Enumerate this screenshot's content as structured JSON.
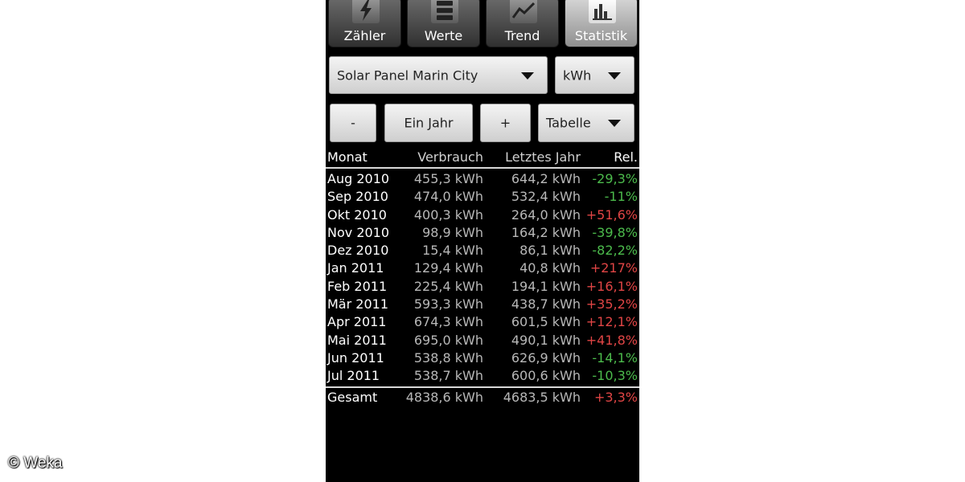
{
  "watermark": "© Weka",
  "tabs": [
    {
      "label": "Zähler",
      "icon": "bolt-icon",
      "active": false
    },
    {
      "label": "Werte",
      "icon": "list-icon",
      "active": false
    },
    {
      "label": "Trend",
      "icon": "trend-icon",
      "active": false
    },
    {
      "label": "Statistik",
      "icon": "bar-chart-icon",
      "active": true
    }
  ],
  "controls": {
    "meter_select": "Solar Panel Marin City",
    "unit_select": "kWh",
    "minus_label": "-",
    "period_label": "Ein Jahr",
    "plus_label": "+",
    "view_select": "Tabelle"
  },
  "table": {
    "headers": {
      "month": "Monat",
      "consumption": "Verbrauch",
      "last_year": "Letztes Jahr",
      "relative": "Rel."
    },
    "rows": [
      {
        "month": "Aug 2010",
        "consumption": "455,3 kWh",
        "last_year": "644,2 kWh",
        "relative": "-29,3%"
      },
      {
        "month": "Sep 2010",
        "consumption": "474,0 kWh",
        "last_year": "532,4 kWh",
        "relative": "-11%"
      },
      {
        "month": "Okt 2010",
        "consumption": "400,3 kWh",
        "last_year": "264,0 kWh",
        "relative": "+51,6%"
      },
      {
        "month": "Nov 2010",
        "consumption": "98,9 kWh",
        "last_year": "164,2 kWh",
        "relative": "-39,8%"
      },
      {
        "month": "Dez 2010",
        "consumption": "15,4 kWh",
        "last_year": "86,1 kWh",
        "relative": "-82,2%"
      },
      {
        "month": "Jan 2011",
        "consumption": "129,4 kWh",
        "last_year": "40,8 kWh",
        "relative": "+217%"
      },
      {
        "month": "Feb 2011",
        "consumption": "225,4 kWh",
        "last_year": "194,1 kWh",
        "relative": "+16,1%"
      },
      {
        "month": "Mär 2011",
        "consumption": "593,3 kWh",
        "last_year": "438,7 kWh",
        "relative": "+35,2%"
      },
      {
        "month": "Apr 2011",
        "consumption": "674,3 kWh",
        "last_year": "601,5 kWh",
        "relative": "+12,1%"
      },
      {
        "month": "Mai 2011",
        "consumption": "695,0 kWh",
        "last_year": "490,1 kWh",
        "relative": "+41,8%"
      },
      {
        "month": "Jun 2011",
        "consumption": "538,8 kWh",
        "last_year": "626,9 kWh",
        "relative": "-14,1%"
      },
      {
        "month": "Jul 2011",
        "consumption": "538,7 kWh",
        "last_year": "600,6 kWh",
        "relative": "-10,3%"
      }
    ],
    "total": {
      "label": "Gesamt",
      "consumption": "4838,6 kWh",
      "last_year": "4683,5 kWh",
      "relative": "+3,3%"
    }
  },
  "colors": {
    "negative": "#4cbb4c",
    "positive": "#e04545",
    "background": "#000000"
  }
}
